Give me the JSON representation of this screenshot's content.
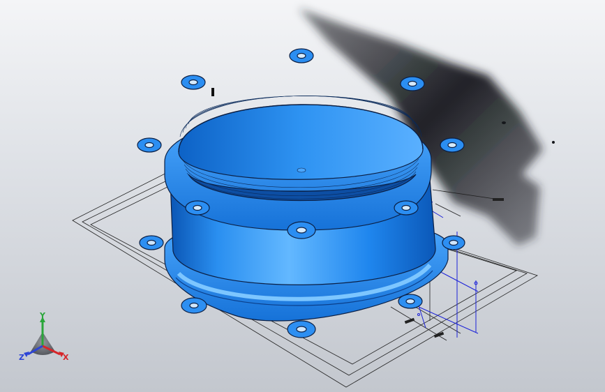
{
  "colors": {
    "background_top": "#f4f5f7",
    "background_bottom": "#c3c7ce",
    "part_body": "#1f86ee",
    "part_highlight": "#5cb4ff",
    "part_dark": "#0a55b4",
    "part_edge": "#0b1f44",
    "shadow": "#1a1d22",
    "sketch_lines": "#202020",
    "sketch_blue": "#1a20d8",
    "axis_x": "#d6262a",
    "axis_y": "#2aa63a",
    "axis_z": "#2c44d6"
  },
  "model": {
    "shape": "flanged pipe coupling",
    "top_flange_bolt_holes": 8,
    "bottom_flange_bolt_holes": 8,
    "shaded": true,
    "shadow": true
  },
  "triad": {
    "x_label": "X",
    "y_label": "Y",
    "z_label": "Z"
  },
  "icons": {
    "orientation_triad": "xyz-triad-icon"
  }
}
